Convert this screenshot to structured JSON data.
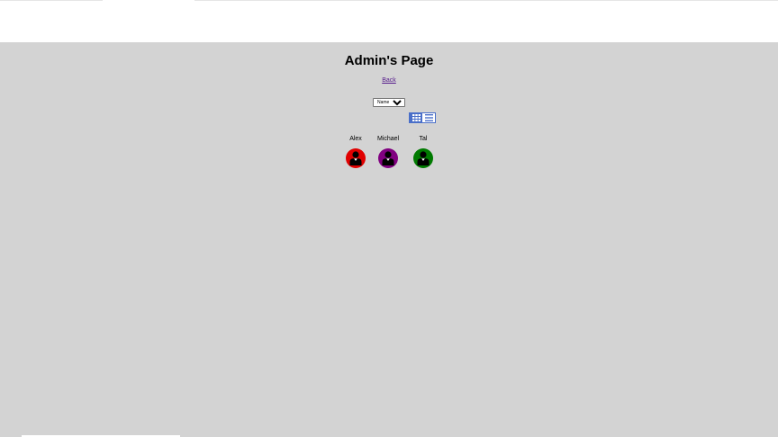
{
  "page": {
    "title": "Admin's Page",
    "back_label": "Back"
  },
  "sort": {
    "selected": "Name",
    "options": [
      "Name"
    ]
  },
  "view_toggle": {
    "grid_icon": "grid-icon",
    "list_icon": "list-icon",
    "active": "grid",
    "accent": "#4a6fc9"
  },
  "users": [
    {
      "name": "Alex",
      "color": "#e00000",
      "icon": "user-icon"
    },
    {
      "name": "Michael",
      "color": "#800080",
      "icon": "user-icon"
    },
    {
      "name": "Tal",
      "color": "#007a00",
      "icon": "user-icon"
    }
  ]
}
